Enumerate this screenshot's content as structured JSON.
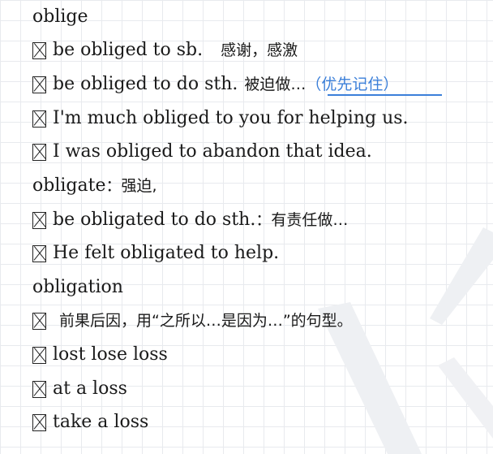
{
  "lines": [
    {
      "text": "oblige"
    },
    {
      "en": "be obliged to sb.",
      "cn": "感谢，感激"
    },
    {
      "en": "be obliged to do sth.",
      "cn": "被迫做…",
      "note": "（优先记住）"
    },
    {
      "en": "I'm much obliged to you for helping us."
    },
    {
      "en": "I was obliged to abandon that idea."
    },
    {
      "head": "obligate",
      "cn": "：强迫,"
    },
    {
      "en": "be obligated to do sth.",
      "cn": "：有责任做…"
    },
    {
      "en": "He felt obligated to help."
    },
    {
      "text": "obligation"
    },
    {
      "cn": "前果后因，用“之所以…是因为…”的句型。"
    },
    {
      "en": "lost lose loss"
    },
    {
      "en": "at a loss"
    },
    {
      "en": "take a loss"
    }
  ],
  "colors": {
    "highlight": "#3b7fd9",
    "grid": "#e8eaee"
  }
}
